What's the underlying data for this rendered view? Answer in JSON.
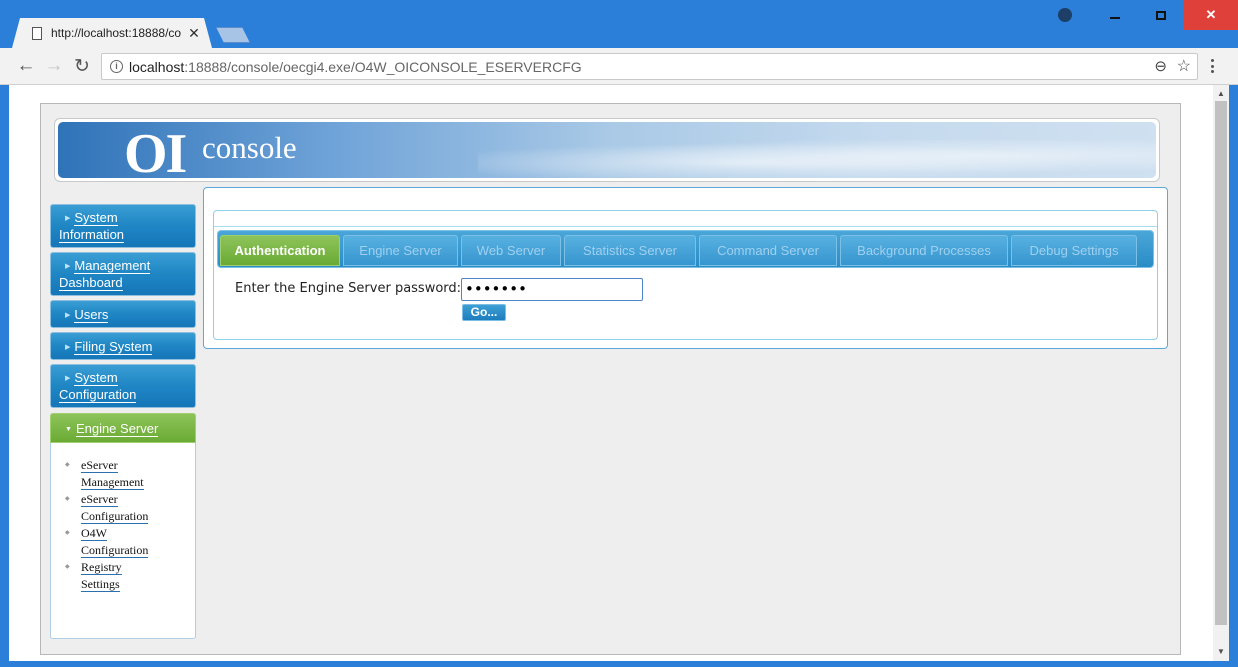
{
  "browser": {
    "tab_title": "http://localhost:18888/co",
    "tab_close": "✕",
    "url_host": "localhost",
    "url_path": ":18888/console/oecgi4.exe/O4W_OICONSOLE_ESERVERCFG",
    "window_close": "✕",
    "back": "←",
    "forward": "→",
    "reload": "↻",
    "zoom": "⊖",
    "star": "☆"
  },
  "banner": {
    "logo_oi": "OI",
    "logo_console": "console"
  },
  "sidebar": {
    "items": [
      {
        "line1": "System",
        "line2": "Information"
      },
      {
        "line1": "Management",
        "line2": "Dashboard"
      },
      {
        "line1": "Users"
      },
      {
        "line1": "Filing System"
      },
      {
        "line1": "System",
        "line2": "Configuration"
      },
      {
        "line1": "Engine Server"
      }
    ],
    "submenu": [
      {
        "line1": "eServer",
        "line2": "Management"
      },
      {
        "line1": "eServer",
        "line2": "Configuration"
      },
      {
        "line1": "O4W",
        "line2": "Configuration"
      },
      {
        "line1": "Registry",
        "line2": "Settings"
      }
    ]
  },
  "tabs": [
    {
      "label": "Authentication",
      "active": true
    },
    {
      "label": "Engine Server"
    },
    {
      "label": "Web Server"
    },
    {
      "label": "Statistics Server"
    },
    {
      "label": "Command Server"
    },
    {
      "label": "Background Processes"
    },
    {
      "label": "Debug Settings"
    }
  ],
  "form": {
    "password_label": "Enter the Engine Server password:",
    "password_value": "•••••••",
    "go_label": "Go..."
  },
  "colors": {
    "active": "#7ab644",
    "nav_blue": "#1f86c4",
    "window_chrome": "#2b7fd8",
    "close_red": "#e0403a"
  }
}
